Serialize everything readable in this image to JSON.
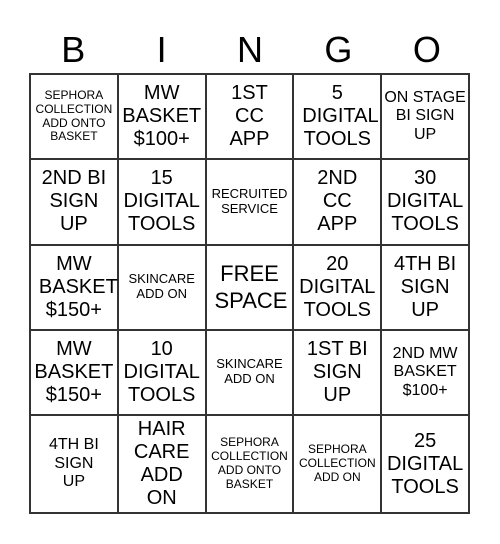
{
  "header": [
    "B",
    "I",
    "N",
    "G",
    "O"
  ],
  "cells": [
    [
      "SEPHORA COLLECTION ADD ONTO BASKET",
      "MW BASKET $100+",
      "1ST CC APP",
      "5 DIGITAL TOOLS",
      "ON STAGE BI SIGN UP"
    ],
    [
      "2ND BI SIGN UP",
      "15 DIGITAL TOOLS",
      "RECRUITED SERVICE",
      "2ND CC APP",
      "30 DIGITAL TOOLS"
    ],
    [
      "MW BASKET $150+",
      "SKINCARE ADD ON",
      "FREE SPACE",
      "20 DIGITAL TOOLS",
      "4TH BI SIGN UP"
    ],
    [
      "MW BASKET $150+",
      "10 DIGITAL TOOLS",
      "SKINCARE ADD ON",
      "1ST BI SIGN UP",
      "2ND MW BASKET $100+"
    ],
    [
      "4TH BI SIGN UP",
      "HAIR CARE ADD ON",
      "SEPHORA COLLECTION ADD ONTO BASKET",
      "SEPHORA COLLECTION ADD ON",
      "25 DIGITAL TOOLS"
    ]
  ]
}
